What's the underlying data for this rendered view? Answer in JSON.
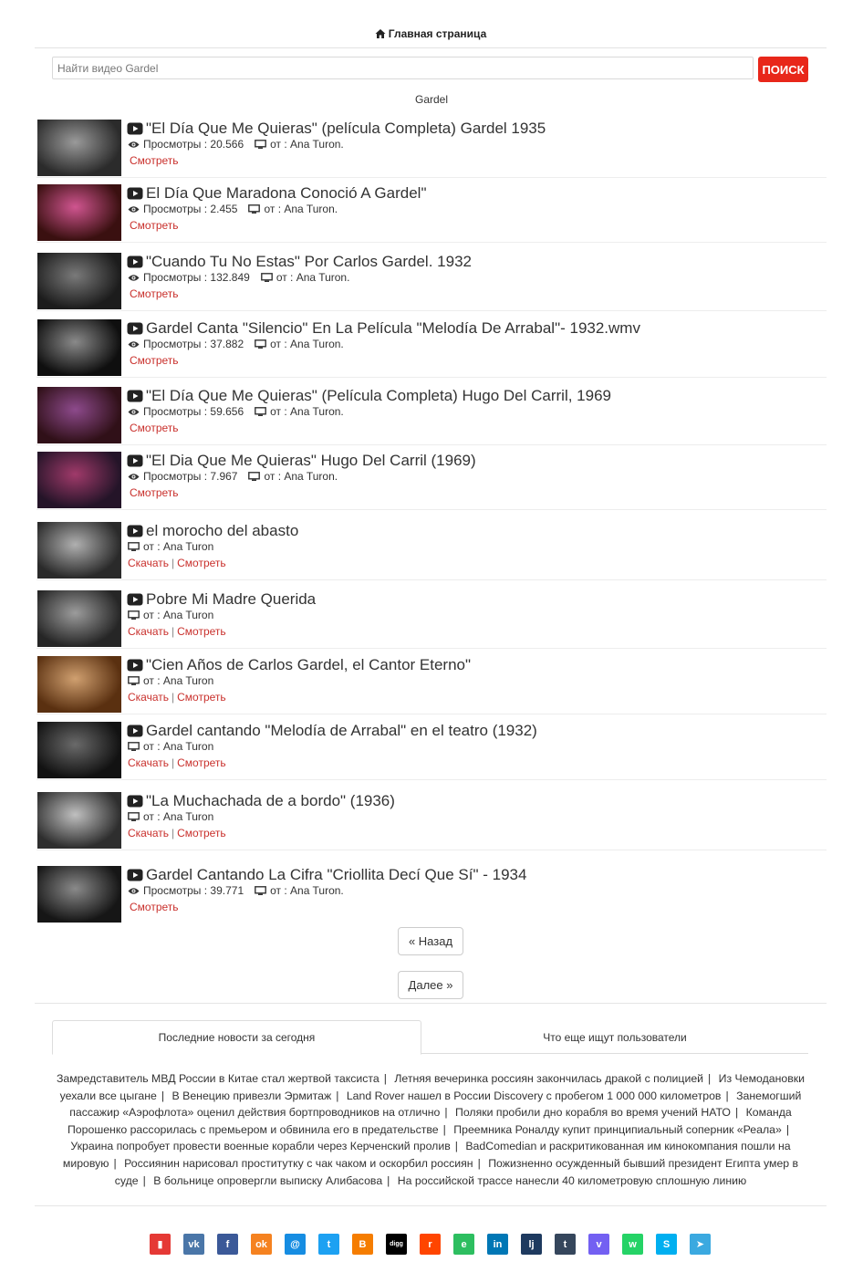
{
  "nav": {
    "home_label": "Главная страница"
  },
  "search": {
    "placeholder": "Найти видео Gardel",
    "button_label": "ПОИСК"
  },
  "query_label": "Gardel",
  "videos": [
    {
      "title": "\"El Día Que Me Quieras\" (película Completa) Gardel 1935",
      "views_label": "Просмотры : 20.566",
      "author_label": "от : Ana Turon.",
      "watch": "Смотреть"
    },
    {
      "title": "El Día Que Maradona Conoció A Gardel\"",
      "views_label": "Просмотры : 2.455",
      "author_label": "от : Ana Turon.",
      "watch": "Смотреть"
    },
    {
      "title": "\"Cuando Tu No Estas\" Por Carlos Gardel. 1932",
      "views_label": "Просмотры : 132.849",
      "author_label": "от : Ana Turon.",
      "watch": "Смотреть"
    },
    {
      "title": "Gardel Canta \"Silencio\" En La Película \"Melodía De Arrabal\"- 1932.wmv",
      "views_label": "Просмотры : 37.882",
      "author_label": "от : Ana Turon.",
      "watch": "Смотреть"
    },
    {
      "title": "\"El Día Que Me Quieras\" (Película Completa) Hugo Del Carril, 1969",
      "views_label": "Просмотры : 59.656",
      "author_label": "от : Ana Turon.",
      "watch": "Смотреть"
    },
    {
      "title": "\"El Dia Que Me Quieras\" Hugo Del Carril (1969)",
      "views_label": "Просмотры : 7.967",
      "author_label": "от : Ana Turon.",
      "watch": "Смотреть"
    },
    {
      "title": "el morocho del abasto",
      "author_label": "от : Ana Turon",
      "download": "Скачать",
      "watch": "Смотреть"
    },
    {
      "title": "Pobre Mi Madre Querida",
      "author_label": "от : Ana Turon",
      "download": "Скачать",
      "watch": "Смотреть"
    },
    {
      "title": "\"Cien Años de Carlos Gardel, el Cantor Eterno\"",
      "author_label": "от : Ana Turon",
      "download": "Скачать",
      "watch": "Смотреть"
    },
    {
      "title": "Gardel cantando \"Melodía de Arrabal\" en el teatro (1932)",
      "author_label": "от : Ana Turon",
      "download": "Скачать",
      "watch": "Смотреть"
    },
    {
      "title": "\"La Muchachada de a bordo\" (1936)",
      "author_label": "от : Ana Turon",
      "download": "Скачать",
      "watch": "Смотреть"
    },
    {
      "title": "Gardel Cantando La Cifra \"Criollita Decí Que Sí\" - 1934",
      "views_label": "Просмотры : 39.771",
      "author_label": "от : Ana Turon.",
      "watch": "Смотреть"
    }
  ],
  "pagination": {
    "prev_label": "« Назад",
    "next_label": "Далее »"
  },
  "tabs": {
    "news_tab": "Последние новости за сегодня",
    "trending_tab": "Что еще ищут пользователи"
  },
  "news": [
    "Замредставитель МВД России в Китае стал жертвой таксиста",
    "Летняя вечеринка россиян закончилась дракой с полицией",
    "Из Чемодановки уехали все цыгане",
    "В Венецию привезли Эрмитаж",
    "Land Rover нашел в России Discovery с пробегом 1 000 000 километров",
    "Занемогший пассажир «Аэрофлота» оценил действия бортпроводников на отлично",
    "Поляки пробили дно корабля во время учений НАТО",
    "Команда Порошенко рассорилась с премьером и обвинила его в предательстве",
    "Преемника Роналду купит принципиальный соперник «Реала»",
    "Украина попробует провести военные корабли через Керченский пролив",
    "BadComedian и раскритикованная им кинокомпания пошли на мировую",
    "Россиянин нарисовал проститутку с чак чаком и оскорбил россиян",
    "Пожизненно осужденный бывший президент Египта умер в суде",
    "В больнице опровергли выписку Алибасова",
    "На российской трассе нанесли 40 километровую сплошную линию"
  ],
  "share": [
    {
      "name": "bookmark",
      "color": "#e53935",
      "glyph": "▮"
    },
    {
      "name": "vk",
      "color": "#4a76a8",
      "glyph": "vk"
    },
    {
      "name": "facebook",
      "color": "#3b5998",
      "glyph": "f"
    },
    {
      "name": "odnoklassniki",
      "color": "#f58220",
      "glyph": "ok"
    },
    {
      "name": "moimir",
      "color": "#168de2",
      "glyph": "@"
    },
    {
      "name": "twitter",
      "color": "#1da1f2",
      "glyph": "t"
    },
    {
      "name": "blogger",
      "color": "#f57d00",
      "glyph": "B"
    },
    {
      "name": "digg",
      "color": "#000000",
      "glyph": "digg"
    },
    {
      "name": "reddit",
      "color": "#ff4500",
      "glyph": "r"
    },
    {
      "name": "evernote",
      "color": "#2dbe60",
      "glyph": "e"
    },
    {
      "name": "linkedin",
      "color": "#0077b5",
      "glyph": "in"
    },
    {
      "name": "livejournal",
      "color": "#1e3a5f",
      "glyph": "lj"
    },
    {
      "name": "tumblr",
      "color": "#35465c",
      "glyph": "t"
    },
    {
      "name": "viber",
      "color": "#7360f2",
      "glyph": "v"
    },
    {
      "name": "whatsapp",
      "color": "#25d366",
      "glyph": "w"
    },
    {
      "name": "skype",
      "color": "#00aff0",
      "glyph": "S"
    },
    {
      "name": "telegram",
      "color": "#3ba9e0",
      "glyph": "➤"
    }
  ]
}
